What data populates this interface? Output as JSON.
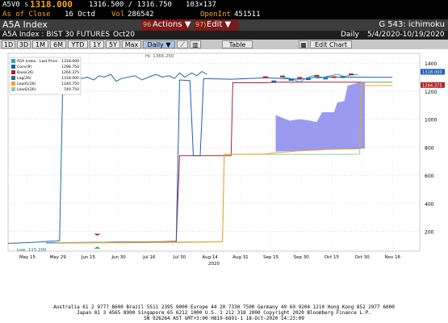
{
  "quote": {
    "ticker": "A5V0",
    "s_label": "s",
    "last": "1318.000",
    "bid_ask": "1316.500 / 1316.750",
    "size": "103×137",
    "asof_label": "As of Close",
    "asof_date": "16 Octd",
    "vol_label": "Vol",
    "vol": "286542",
    "oi_label": "OpenInt",
    "oi": "451511"
  },
  "titlebar": {
    "title": "A5A Index",
    "actions_num": "96",
    "actions": "Actions ▼",
    "edit_num": "97)",
    "edit": "Edit ▼",
    "page": "G 543: ichimoku"
  },
  "subheader": {
    "security": "A5A Index : BIST 30 FUTURES",
    "contract": "Oct20",
    "period": "Daily",
    "range": "5/4/2020-10/19/2020"
  },
  "toolbar": {
    "periods": [
      "1D",
      "3D",
      "1M",
      "6M",
      "YTD",
      "1Y",
      "5Y",
      "Max"
    ],
    "frequency": "Daily ▼",
    "table": "Table",
    "edit_chart": "Edit Chart"
  },
  "colors": {
    "price": "#2aa8b4",
    "conv": "#1e5bb5",
    "base": "#b22222",
    "lag": "#1f6f8b",
    "lead1": "#f0a030",
    "lead2": "#8fd18f",
    "cloud": "#8888ee"
  },
  "chart_data": {
    "type": "line",
    "y_ticks": [
      "1400",
      "1200",
      "1000",
      "800",
      "600",
      "400",
      "200"
    ],
    "ylim": [
      60,
      1470
    ],
    "x_labels": [
      "May 15",
      "May 29",
      "Jun 15",
      "Jun 30",
      "Jul 16",
      "Jul 30",
      "Aug 14",
      "Aug 31",
      "Sep 15",
      "Sep 30",
      "Oct 15",
      "Oct 30",
      "Nov 16"
    ],
    "x_year": "2020",
    "legend": [
      {
        "name": "A5A Index - Last Price",
        "value": "1318.000",
        "color": "#2aa8b4"
      },
      {
        "name": "Conv(9)",
        "value": "1298.750",
        "color": "#1e5bb5"
      },
      {
        "name": "Base(26)",
        "value": "1264.375",
        "color": "#b22222"
      },
      {
        "name": "Lag(26)",
        "value": "1318.000",
        "color": "#1f6f8b"
      },
      {
        "name": "Lead1(26)",
        "value": "1240.750",
        "color": "#f0a030"
      },
      {
        "name": "Lead2(26)",
        "value": "749.750",
        "color": "#8fd18f"
      }
    ],
    "annotations": {
      "high": "Hi: 1366.250",
      "low": "Low: 115.200"
    },
    "right_labels": [
      {
        "value": 1318,
        "text": "1318.000",
        "bg": "#1e5bb5"
      },
      {
        "value": 1264,
        "text": "1264.375",
        "bg": "#b22222"
      }
    ],
    "series": [
      {
        "name": "Lag(26)",
        "color": "#1f6f8b",
        "points": [
          [
            0,
            115
          ],
          [
            10,
            120
          ],
          [
            18,
            125
          ],
          [
            24,
            130
          ],
          [
            28,
            132
          ],
          [
            30,
            135
          ],
          [
            32,
            1330
          ],
          [
            34,
            1300
          ],
          [
            37,
            1270
          ],
          [
            40,
            1320
          ],
          [
            43,
            1290
          ],
          [
            46,
            1300
          ],
          [
            50,
            1280
          ],
          [
            53,
            1310
          ],
          [
            56,
            1300
          ],
          [
            60,
            1320
          ],
          [
            63,
            1270
          ],
          [
            66,
            1290
          ],
          [
            70,
            1300
          ],
          [
            74,
            1310
          ],
          [
            78,
            1280
          ],
          [
            82,
            1300
          ],
          [
            86,
            1320
          ],
          [
            90,
            1300
          ],
          [
            94,
            1310
          ],
          [
            97,
            1290
          ],
          [
            100,
            1330
          ],
          [
            103,
            1300
          ],
          [
            107,
            1330
          ],
          [
            110,
            1310
          ],
          [
            113,
            1340
          ],
          [
            116,
            1320
          ]
        ]
      },
      {
        "name": "Base(26)",
        "color": "#b22222",
        "points": [
          [
            32,
            120
          ],
          [
            46,
            120
          ],
          [
            62,
            125
          ],
          [
            90,
            128
          ],
          [
            98,
            130
          ],
          [
            100,
            740
          ],
          [
            112,
            740
          ],
          [
            130,
            740
          ],
          [
            131,
            1260
          ],
          [
            150,
            1260
          ],
          [
            160,
            1265
          ],
          [
            175,
            1264
          ],
          [
            200,
            1264
          ],
          [
            210,
            1264
          ],
          [
            224,
            1264
          ]
        ]
      },
      {
        "name": "Conv(9)",
        "color": "#1e5bb5",
        "points": [
          [
            22,
            118
          ],
          [
            44,
            122
          ],
          [
            66,
            125
          ],
          [
            80,
            125
          ],
          [
            98,
            126
          ],
          [
            100,
            1280
          ],
          [
            106,
            1275
          ],
          [
            108,
            740
          ],
          [
            112,
            740
          ],
          [
            114,
            1290
          ],
          [
            130,
            1285
          ],
          [
            150,
            1295
          ],
          [
            170,
            1285
          ],
          [
            180,
            1300
          ],
          [
            200,
            1300
          ],
          [
            220,
            1299
          ],
          [
            224,
            1299
          ]
        ]
      },
      {
        "name": "Lead2(26)",
        "color": "#8fd18f",
        "points": [
          [
            28,
            118
          ],
          [
            40,
            120
          ],
          [
            60,
            122
          ],
          [
            90,
            125
          ],
          [
            120,
            127
          ],
          [
            125,
            128
          ],
          [
            126,
            750
          ],
          [
            160,
            750
          ],
          [
            200,
            750
          ],
          [
            205,
            752
          ],
          [
            206,
            1265
          ],
          [
            214,
            1265
          ],
          [
            224,
            1265
          ]
        ]
      },
      {
        "name": "Lead1(26)",
        "color": "#f0a030",
        "points": [
          [
            28,
            117
          ],
          [
            60,
            119
          ],
          [
            100,
            122
          ],
          [
            125,
            127
          ],
          [
            126,
            750
          ],
          [
            150,
            752
          ],
          [
            155,
            760
          ],
          [
            165,
            770
          ],
          [
            170,
            775
          ],
          [
            180,
            780
          ],
          [
            186,
            785
          ],
          [
            205,
            790
          ],
          [
            206,
            1240
          ],
          [
            214,
            1240
          ],
          [
            224,
            1241
          ]
        ]
      },
      {
        "name": "A5A Index - Last Price",
        "color": "#2aa8b4",
        "points": [
          [
            160,
            1300
          ],
          [
            165,
            1290
          ],
          [
            170,
            1265
          ],
          [
            172,
            1280
          ],
          [
            175,
            1300
          ],
          [
            178,
            1310
          ],
          [
            180,
            1290
          ],
          [
            184,
            1300
          ],
          [
            188,
            1310
          ],
          [
            192,
            1320
          ],
          [
            196,
            1305
          ],
          [
            200,
            1315
          ],
          [
            204,
            1318
          ]
        ]
      }
    ],
    "cloud": {
      "color": "#8888ee",
      "x_start": 156,
      "x_end": 208,
      "top": [
        [
          156,
          1030
        ],
        [
          164,
          990
        ],
        [
          170,
          1000
        ],
        [
          176,
          990
        ],
        [
          180,
          980
        ],
        [
          183,
          1050
        ],
        [
          190,
          1050
        ],
        [
          192,
          1120
        ],
        [
          196,
          1130
        ],
        [
          198,
          1240
        ],
        [
          204,
          1260
        ],
        [
          208,
          1264
        ]
      ],
      "bottom": [
        [
          156,
          770
        ],
        [
          170,
          775
        ],
        [
          180,
          780
        ],
        [
          190,
          785
        ],
        [
          200,
          785
        ],
        [
          206,
          790
        ],
        [
          208,
          790
        ]
      ]
    },
    "markers": [
      {
        "series": "Base(26)",
        "points": [
          [
            150,
            1300
          ],
          [
            160,
            1305
          ],
          [
            170,
            1295
          ],
          [
            180,
            1310
          ],
          [
            190,
            1300
          ],
          [
            200,
            1320
          ]
        ]
      },
      {
        "series": "Conv(9)",
        "points": [
          [
            155,
            1270
          ],
          [
            165,
            1280
          ],
          [
            175,
            1285
          ],
          [
            185,
            1290
          ],
          [
            195,
            1300
          ]
        ]
      }
    ]
  },
  "footer": {
    "line1": "Australia 61 2 9777 8600 Brazil 5511 2395 9000 Europe 44 20 7330 7500 Germany 49 69 9204 1210 Hong Kong 852 2977 6000",
    "line2": "Japan 81 3 4565 8900     Singapore 65 6212 1000     U.S. 1 212 318 2000     Copyright 2020 Bloomberg Finance L.P.",
    "line3": "SN 926264 AST  GMT+3:00 H819-6891-1 18-Oct-2020 14:23:09"
  }
}
